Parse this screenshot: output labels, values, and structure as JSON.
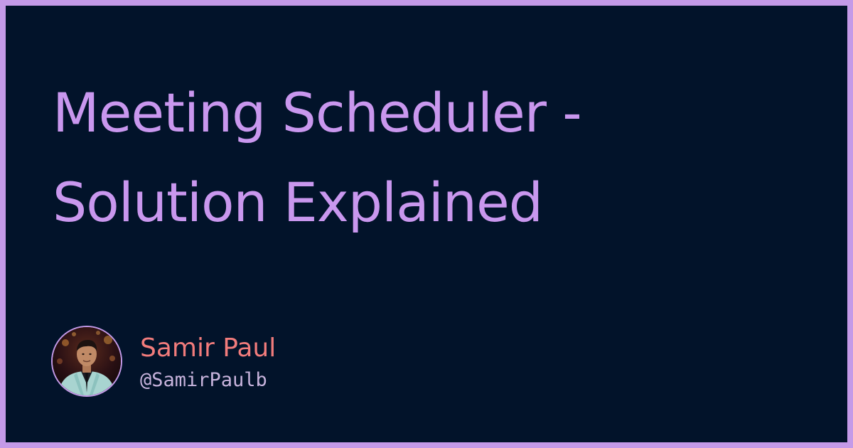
{
  "title": {
    "line1": "Meeting Scheduler -",
    "line2": "Solution Explained"
  },
  "author": {
    "name": "Samir Paul",
    "handle": "@SamirPaulb"
  },
  "colors": {
    "frame": "#c49ae8",
    "background": "#02132a",
    "title": "#c997ee",
    "name": "#f27c7c",
    "handle": "#c7b3dc"
  }
}
